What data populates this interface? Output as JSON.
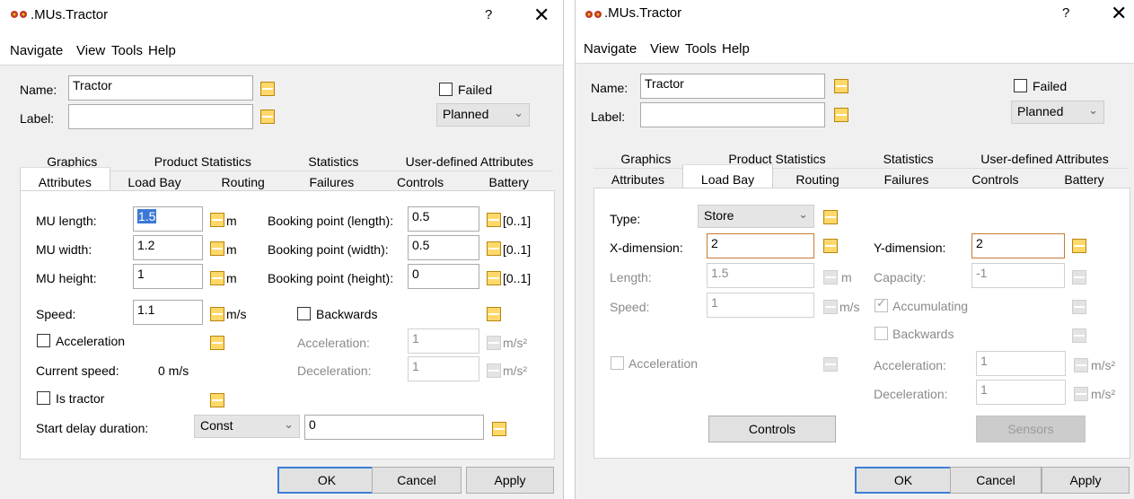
{
  "window": {
    "title": ".MUs.Tractor",
    "help": "?",
    "close": "✕"
  },
  "menu": [
    "Navigate",
    "View",
    "Tools",
    "Help"
  ],
  "header": {
    "name_label": "Name:",
    "name_value": "Tractor",
    "label_label": "Label:",
    "label_value": "",
    "failed_label": "Failed",
    "failed_checked": false,
    "status_value": "Planned"
  },
  "tabs": {
    "upper": [
      "Graphics",
      "Product Statistics",
      "Statistics",
      "User-defined Attributes"
    ],
    "lower": [
      "Attributes",
      "Load Bay",
      "Routing",
      "Failures",
      "Controls",
      "Battery"
    ]
  },
  "attributes_tab": {
    "mu_length_label": "MU length:",
    "mu_length": "1.5",
    "mu_width_label": "MU width:",
    "mu_width": "1.2",
    "mu_height_label": "MU height:",
    "mu_height": "1",
    "unit_m": "m",
    "booking_length_label": "Booking point (length):",
    "booking_length": "0.5",
    "booking_width_label": "Booking point (width):",
    "booking_width": "0.5",
    "booking_height_label": "Booking point (height):",
    "booking_height": "0",
    "range_unit": "[0..1]",
    "speed_label": "Speed:",
    "speed": "1.1",
    "speed_unit": "m/s",
    "backwards_label": "Backwards",
    "acceleration_label": "Acceleration",
    "accel_label": "Acceleration:",
    "accel_value": "1",
    "accel_unit": "m/s²",
    "current_speed_label": "Current speed:",
    "current_speed": "0 m/s",
    "decel_label": "Deceleration:",
    "decel_value": "1",
    "decel_unit": "m/s²",
    "is_tractor_label": "Is tractor",
    "start_delay_label": "Start delay duration:",
    "start_delay_type": "Const",
    "start_delay_value": "0"
  },
  "loadbay_tab": {
    "type_label": "Type:",
    "type_value": "Store",
    "x_dim_label": "X-dimension:",
    "x_dim": "2",
    "y_dim_label": "Y-dimension:",
    "y_dim": "2",
    "length_label": "Length:",
    "length": "1.5",
    "length_unit": "m",
    "capacity_label": "Capacity:",
    "capacity": "-1",
    "speed_label": "Speed:",
    "speed": "1",
    "speed_unit": "m/s",
    "accumulating_label": "Accumulating",
    "backwards_label": "Backwards",
    "acceleration_label": "Acceleration",
    "accel_label": "Acceleration:",
    "accel_value": "1",
    "accel_unit": "m/s²",
    "decel_label": "Deceleration:",
    "decel_value": "1",
    "decel_unit": "m/s²",
    "controls_button": "Controls",
    "sensors_button": "Sensors"
  },
  "buttons": {
    "ok": "OK",
    "cancel": "Cancel",
    "apply": "Apply"
  },
  "colors": {
    "control_icon": "#ffd86a",
    "selection": "#3b78d6",
    "ok_border": "#3c7fd6"
  }
}
